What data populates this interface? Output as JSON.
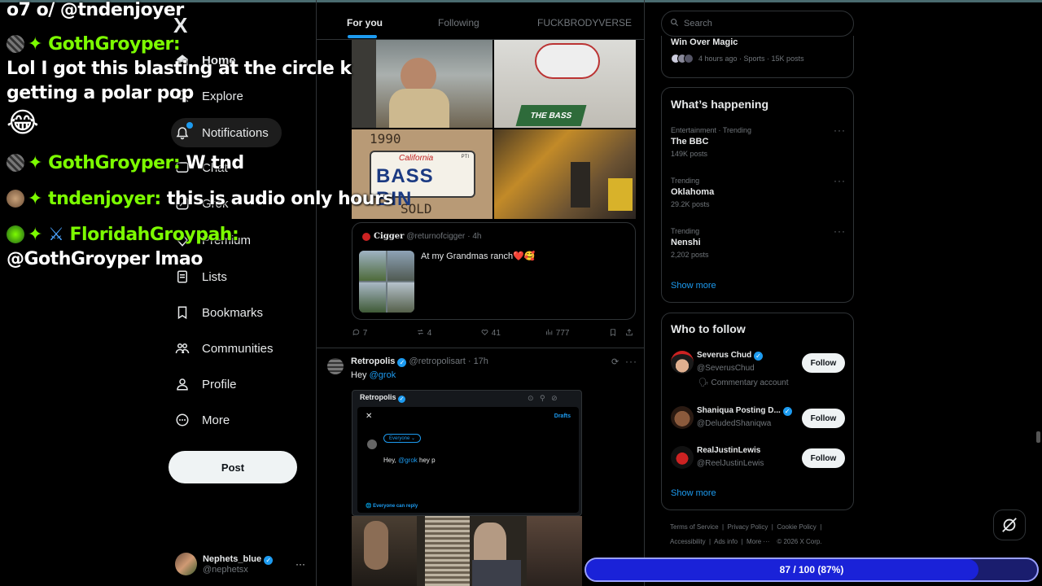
{
  "chat": [
    {
      "line1": "o7 o/ @tndenjoyer"
    },
    {
      "user": "GothGroyper:",
      "message": "Lol I got this blasting at the circle k getting a polar pop",
      "emoji": "😂"
    },
    {
      "user": "GothGroyper:",
      "message": "W tnd"
    },
    {
      "user": "tndenjoyer:",
      "message": "this is audio only hours"
    },
    {
      "user": "FloridahGroypah:",
      "message": "@GothGroyper lmao"
    }
  ],
  "nav": {
    "logo": "X",
    "items": [
      {
        "label": "Home"
      },
      {
        "label": "Explore"
      },
      {
        "label": "Notifications"
      },
      {
        "label": "Chat"
      },
      {
        "label": "Grok"
      },
      {
        "label": "Premium"
      },
      {
        "label": "Lists"
      },
      {
        "label": "Bookmarks"
      },
      {
        "label": "Communities"
      },
      {
        "label": "Profile"
      },
      {
        "label": "More"
      }
    ],
    "post_label": "Post",
    "account": {
      "name": "Nephets_blue",
      "handle": "@nephetsx",
      "more": "···"
    }
  },
  "timeline": {
    "tabs": [
      "For you",
      "Following",
      "FUCKBRODYVERSE"
    ],
    "photo_caption": {
      "year": "1990",
      "plate_state": "California",
      "plate_text": "BASS BIN",
      "plate_corner": "PTI",
      "sold": "SOLD",
      "bass_sign": "THE BASS"
    },
    "quote": {
      "name": "Cigger",
      "handle": "@returnofcigger",
      "time": "· 4h",
      "text": "At my Grandmas ranch❤️🥰"
    },
    "actions": {
      "replies": "7",
      "reposts": "4",
      "likes": "41",
      "views": "777"
    },
    "post2": {
      "name": "Retropolis",
      "handle": "@retropolisart",
      "time": "· 17h",
      "text_prefix": "Hey ",
      "mention": "@grok",
      "embed": {
        "name": "Retropolis",
        "drafts": "Drafts",
        "audience": "Everyone",
        "compose_prefix": "Hey, ",
        "compose_mention": "@grok",
        "compose_suffix": " hey p",
        "reply_setting": "Everyone can reply"
      }
    }
  },
  "right": {
    "search_placeholder": "Search",
    "top_item": {
      "title": "Win Over Magic",
      "meta": "4 hours ago · Sports · 15K posts"
    },
    "happening": {
      "title": "What’s happening",
      "trends": [
        {
          "meta": "Entertainment · Trending",
          "name": "The BBC",
          "posts": "149K posts"
        },
        {
          "meta": "Trending",
          "name": "Oklahoma",
          "posts": "29.2K posts"
        },
        {
          "meta": "Trending",
          "name": "Nenshi",
          "posts": "2,202 posts"
        }
      ],
      "show_more": "Show more"
    },
    "who_to_follow": {
      "title": "Who to follow",
      "people": [
        {
          "name": "Severus Chud",
          "handle": "@SeverusChud",
          "extra": "Commentary account",
          "button": "Follow"
        },
        {
          "name": "Shaniqua Posting D...",
          "handle": "@DeludedShaniqwa",
          "button": "Follow"
        },
        {
          "name": "RealJustinLewis",
          "handle": "@ReelJustinLewis",
          "button": "Follow"
        }
      ],
      "show_more": "Show more"
    },
    "footer": {
      "line1": [
        "Terms of Service",
        "Privacy Policy",
        "Cookie Policy"
      ],
      "line2": [
        "Accessibility",
        "Ads info",
        "More ···",
        "© 2026 X Corp."
      ]
    }
  },
  "progress": {
    "label": "87 / 100 (87%)",
    "fraction": 0.87
  },
  "colors": {
    "accent": "#1d9bf0",
    "chat_user": "#7CFC00",
    "progress_fill": "#1a22d8"
  }
}
